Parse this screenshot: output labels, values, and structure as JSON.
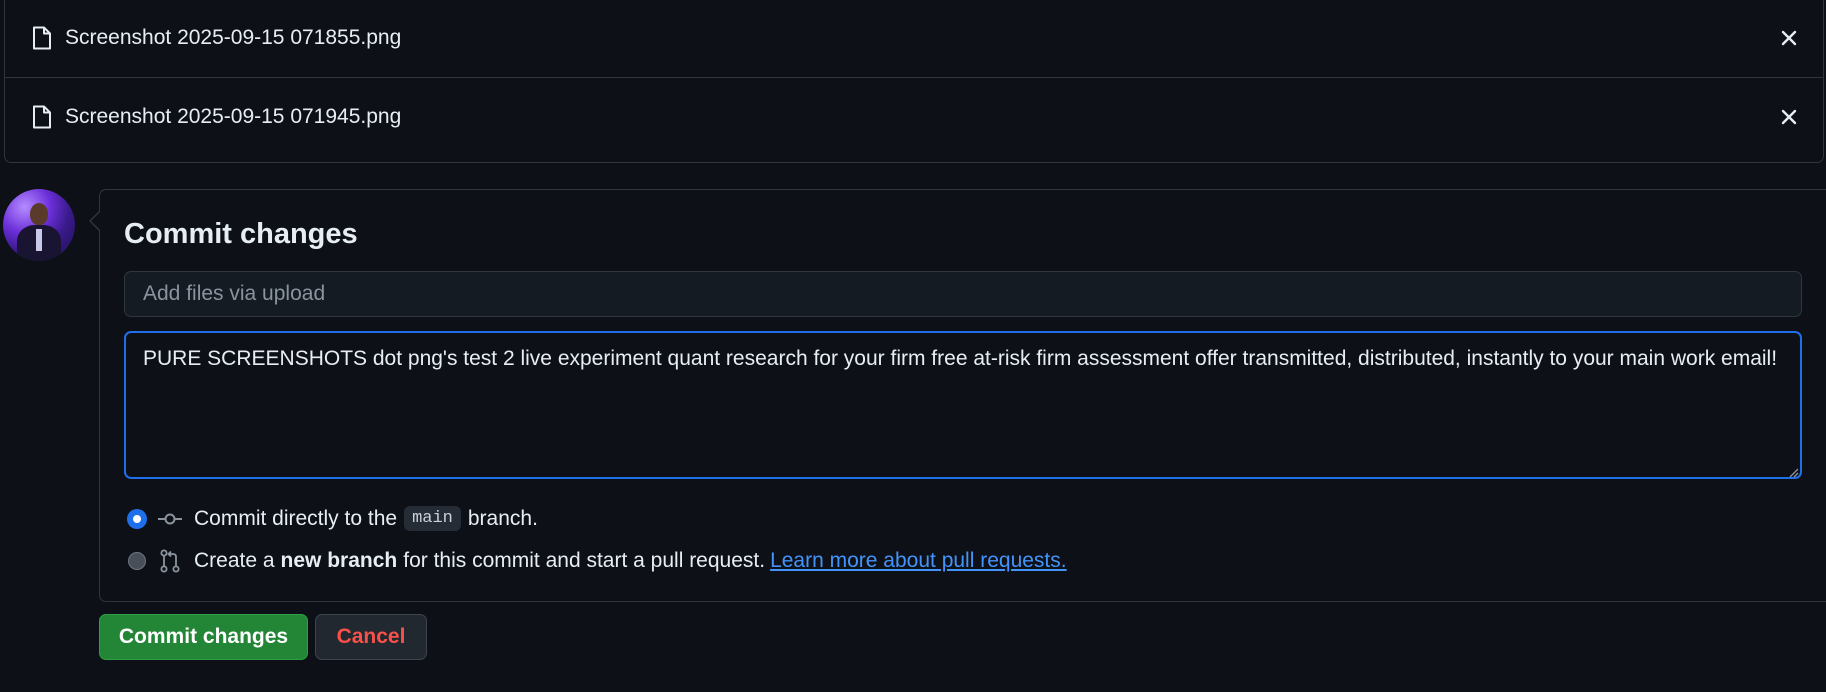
{
  "files": [
    {
      "name": "Screenshot 2025-09-15 071855.png",
      "icon": "file-icon",
      "remove_icon": "close-icon"
    },
    {
      "name": "Screenshot 2025-09-15 071945.png",
      "icon": "file-icon",
      "remove_icon": "close-icon"
    }
  ],
  "commit": {
    "title": "Commit changes",
    "summary": {
      "value": "",
      "placeholder": "Add files via upload"
    },
    "description": {
      "value": "PURE SCREENSHOTS dot png's test 2 live experiment quant research for your firm free at-risk firm assessment offer transmitted, distributed, instantly to your main work email!"
    },
    "options": {
      "direct": {
        "selected": true,
        "prefix": "Commit directly to the",
        "branch": "main",
        "suffix": "branch.",
        "icon": "git-commit-icon"
      },
      "new_branch": {
        "selected": false,
        "prefix": "Create a",
        "bold": "new branch",
        "suffix": "for this commit and start a pull request.",
        "link": "Learn more about pull requests.",
        "icon": "git-pull-request-icon"
      }
    }
  },
  "buttons": {
    "commit_label": "Commit changes",
    "cancel_label": "Cancel"
  },
  "colors": {
    "background": "#0d1117",
    "border": "#30363d",
    "accent": "#1f6feb",
    "primary_button": "#238636",
    "danger_text": "#f85149",
    "link": "#4493f8"
  }
}
